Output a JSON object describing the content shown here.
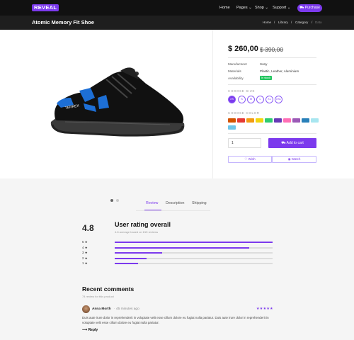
{
  "nav": {
    "logo": "REVEAL",
    "items": [
      "Home",
      "Pages ⌄",
      "Shop ⌄",
      "Support ⌄"
    ],
    "purchase_label": "Purchase"
  },
  "header": {
    "title": "Atomic Memory Fit Shoe",
    "breadcrumb": [
      "Home",
      "/",
      "Library",
      "/",
      "Category",
      "/",
      "Data"
    ]
  },
  "product": {
    "price": "$ 260,00",
    "old_price": "$ 390,00",
    "specs": [
      {
        "key": "Manufacturer",
        "value": "Sony"
      },
      {
        "key": "Materials",
        "value": "Plastic, Leather, Aluminium"
      },
      {
        "key": "Availability",
        "value": "In stock"
      }
    ],
    "choose_size_label": "CHOOSE SIZE",
    "sizes": [
      "XS",
      "S",
      "M",
      "L",
      "XL",
      "XXL"
    ],
    "selected_size": "XS",
    "choose_color_label": "CHOOSE COLOR",
    "colors": [
      "#d35400",
      "#e53935",
      "#f39c12",
      "#f1d60f",
      "#2ecc71",
      "#673ab7",
      "#ff6fb5",
      "#9b59b6",
      "#2980b9",
      "#a8e6f0",
      "#6ec6ea"
    ],
    "quantity": "1",
    "add_to_cart_label": "Add to cart",
    "wish_label": "Wish",
    "watch_label": "Watch",
    "gallery_dots": 2,
    "gallery_active_dot": 0
  },
  "tabs": {
    "items": [
      "Review",
      "Description",
      "Shipping"
    ],
    "active": "Review"
  },
  "rating": {
    "score": "4.8",
    "heading": "User rating overall",
    "subtitle": "4.8 average based on 615 reviews",
    "bars": [
      {
        "label": "5 ★",
        "value": 1.0
      },
      {
        "label": "4 ★",
        "value": 0.85
      },
      {
        "label": "3 ★",
        "value": 0.3
      },
      {
        "label": "2 ★",
        "value": 0.2
      },
      {
        "label": "1 ★",
        "value": 0.15
      }
    ]
  },
  "comments": {
    "heading": "Recent comments",
    "subtitle": "74 review for this product",
    "items": [
      {
        "name": "Anna Morth",
        "time": "· 45 minutes ago",
        "stars": "★★★★★",
        "text": "Duis aute irure dolor in reprehenderit in voluptate velit esse cillum dolore eu fugiat nulla pariatur. Duis aute irure dolor in reprehenderit in voluptate velit esse cillum dolore eu fugiat nulla pariatur.",
        "reply_label": "Reply"
      }
    ]
  }
}
